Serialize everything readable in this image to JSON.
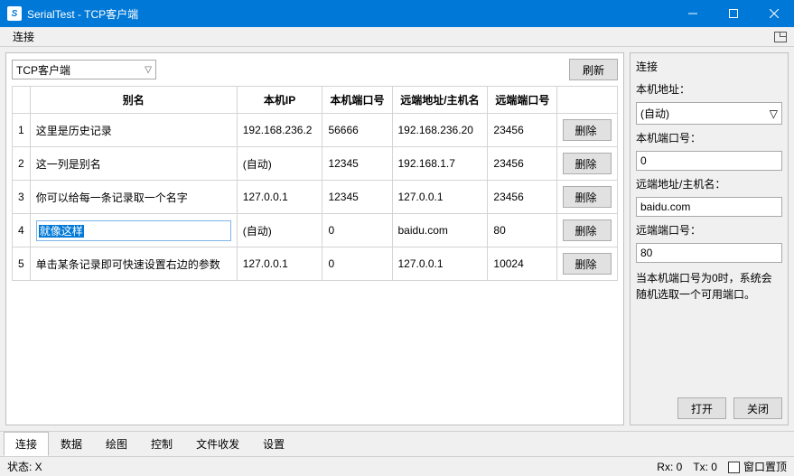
{
  "window": {
    "title": "SerialTest - TCP客户端"
  },
  "menubar": {
    "connect": "连接"
  },
  "left": {
    "mode": "TCP客户端",
    "refresh": "刷新",
    "headers": {
      "alias": "别名",
      "localIP": "本机IP",
      "localPort": "本机端口号",
      "remoteAddr": "远端地址/主机名",
      "remotePort": "远端端口号"
    },
    "delete_label": "删除",
    "rows": [
      {
        "n": "1",
        "alias": "这里是历史记录",
        "lip": "192.168.236.2",
        "lport": "56666",
        "raddr": "192.168.236.20",
        "rport": "23456"
      },
      {
        "n": "2",
        "alias": "这一列是别名",
        "lip": "(自动)",
        "lport": "12345",
        "raddr": "192.168.1.7",
        "rport": "23456"
      },
      {
        "n": "3",
        "alias": "你可以给每一条记录取一个名字",
        "lip": "127.0.0.1",
        "lport": "12345",
        "raddr": "127.0.0.1",
        "rport": "23456"
      },
      {
        "n": "4",
        "alias": "就像这样",
        "lip": "(自动)",
        "lport": "0",
        "raddr": "baidu.com",
        "rport": "80",
        "editing": true
      },
      {
        "n": "5",
        "alias": "单击某条记录即可快速设置右边的参数",
        "lip": "127.0.0.1",
        "lport": "0",
        "raddr": "127.0.0.1",
        "rport": "10024"
      }
    ]
  },
  "right": {
    "title": "连接",
    "localAddr_label": "本机地址：",
    "localAddr_value": "(自动)",
    "localPort_label": "本机端口号：",
    "localPort_value": "0",
    "remoteAddr_label": "远端地址/主机名：",
    "remoteAddr_value": "baidu.com",
    "remotePort_label": "远端端口号：",
    "remotePort_value": "80",
    "hint": "当本机端口号为0时，系统会随机选取一个可用端口。",
    "open": "打开",
    "close": "关闭"
  },
  "tabs": {
    "t0": "连接",
    "t1": "数据",
    "t2": "绘图",
    "t3": "控制",
    "t4": "文件收发",
    "t5": "设置"
  },
  "status": {
    "left": "状态: X",
    "rx": "Rx: 0",
    "tx": "Tx: 0",
    "topmost": "窗口置顶"
  }
}
